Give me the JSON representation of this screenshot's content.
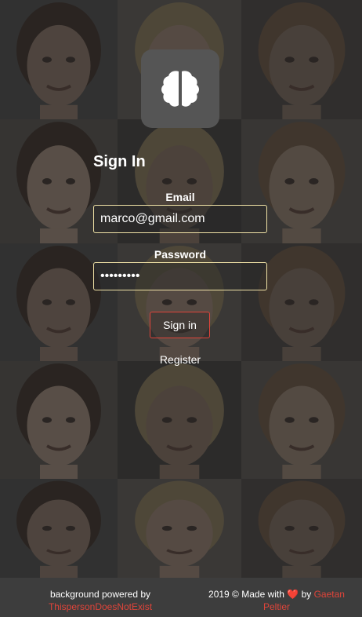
{
  "login": {
    "title": "Sign In",
    "email_label": "Email",
    "email_value": "marco@gmail.com",
    "password_label": "Password",
    "password_value": "password1",
    "signin_label": "Sign in",
    "register_label": "Register"
  },
  "footer": {
    "bg_text": "background powered by",
    "bg_link": "ThispersonDoesNotExist",
    "made_prefix": "2019 © Made with",
    "heart": "❤️",
    "by_text": "by",
    "author_link": "Gaetan Peltier"
  },
  "icons": {
    "logo": "brain-icon"
  },
  "colors": {
    "accent": "#e0443a",
    "input_border": "#f0e2a6",
    "logo_bg": "#555555",
    "footer_bg": "#3d3d3d"
  }
}
